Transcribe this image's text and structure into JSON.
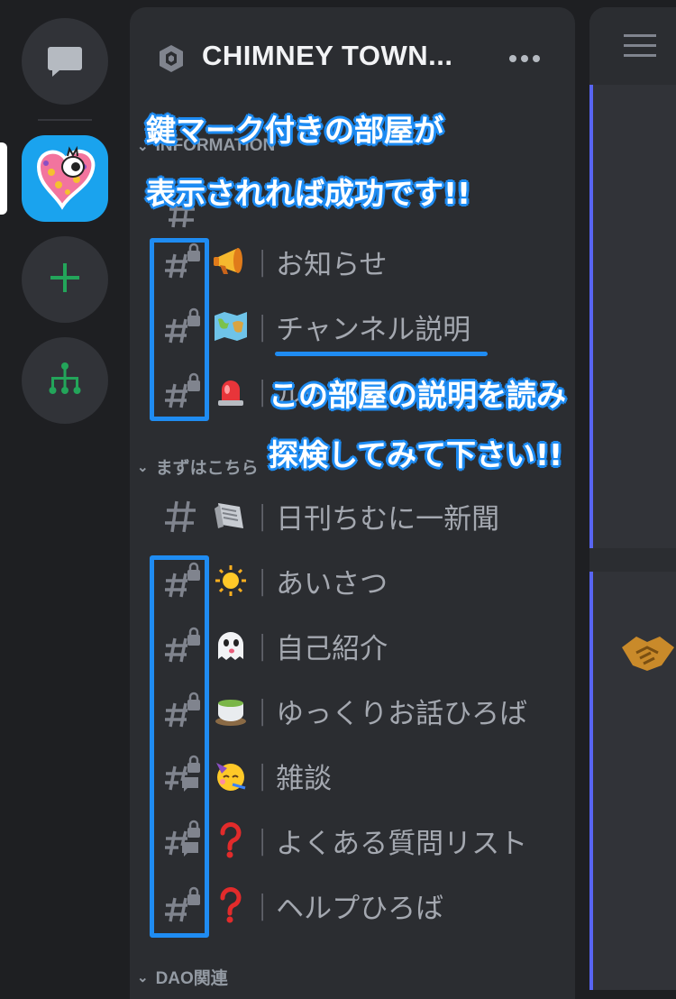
{
  "server": {
    "name": "CHIMNEY TOWN...",
    "more": "•••"
  },
  "categories": {
    "first": "INFORMATION",
    "second": "まずはこちら",
    "third": "DAO関連"
  },
  "channels": [
    {
      "hash": "locked",
      "emoji": "📣",
      "name": "お知らせ"
    },
    {
      "hash": "locked",
      "emoji": "🗺️",
      "name": "チャンネル説明"
    },
    {
      "hash": "locked",
      "emoji": "🚨",
      "name": "ルール"
    },
    {
      "hash": "plain",
      "emoji": "🗞️",
      "name": "日刊ちむに一新聞"
    },
    {
      "hash": "locked",
      "emoji": "☀️",
      "name": "あいさつ"
    },
    {
      "hash": "locked",
      "emoji": "👻",
      "name": "自己紹介"
    },
    {
      "hash": "locked",
      "emoji": "🍵",
      "name": "ゆっくりお話ひろば"
    },
    {
      "hash": "locked-thread",
      "emoji": "🥳",
      "name": "雑談"
    },
    {
      "hash": "locked-thread",
      "emoji": "❓",
      "name": "よくある質問リスト"
    },
    {
      "hash": "locked",
      "emoji": "❓",
      "name": "ヘルプひろば"
    }
  ],
  "annotations": {
    "top_line1": "鍵マーク付きの部屋が",
    "top_line2": "表示されれば成功です!!",
    "mid_line1": "この部屋の説明を読み",
    "mid_line2": "探検してみて下さい!!"
  },
  "colors": {
    "accent": "#1f8cf2",
    "panel": "#2b2d31",
    "rail": "#1e1f22",
    "green": "#23a55a"
  }
}
